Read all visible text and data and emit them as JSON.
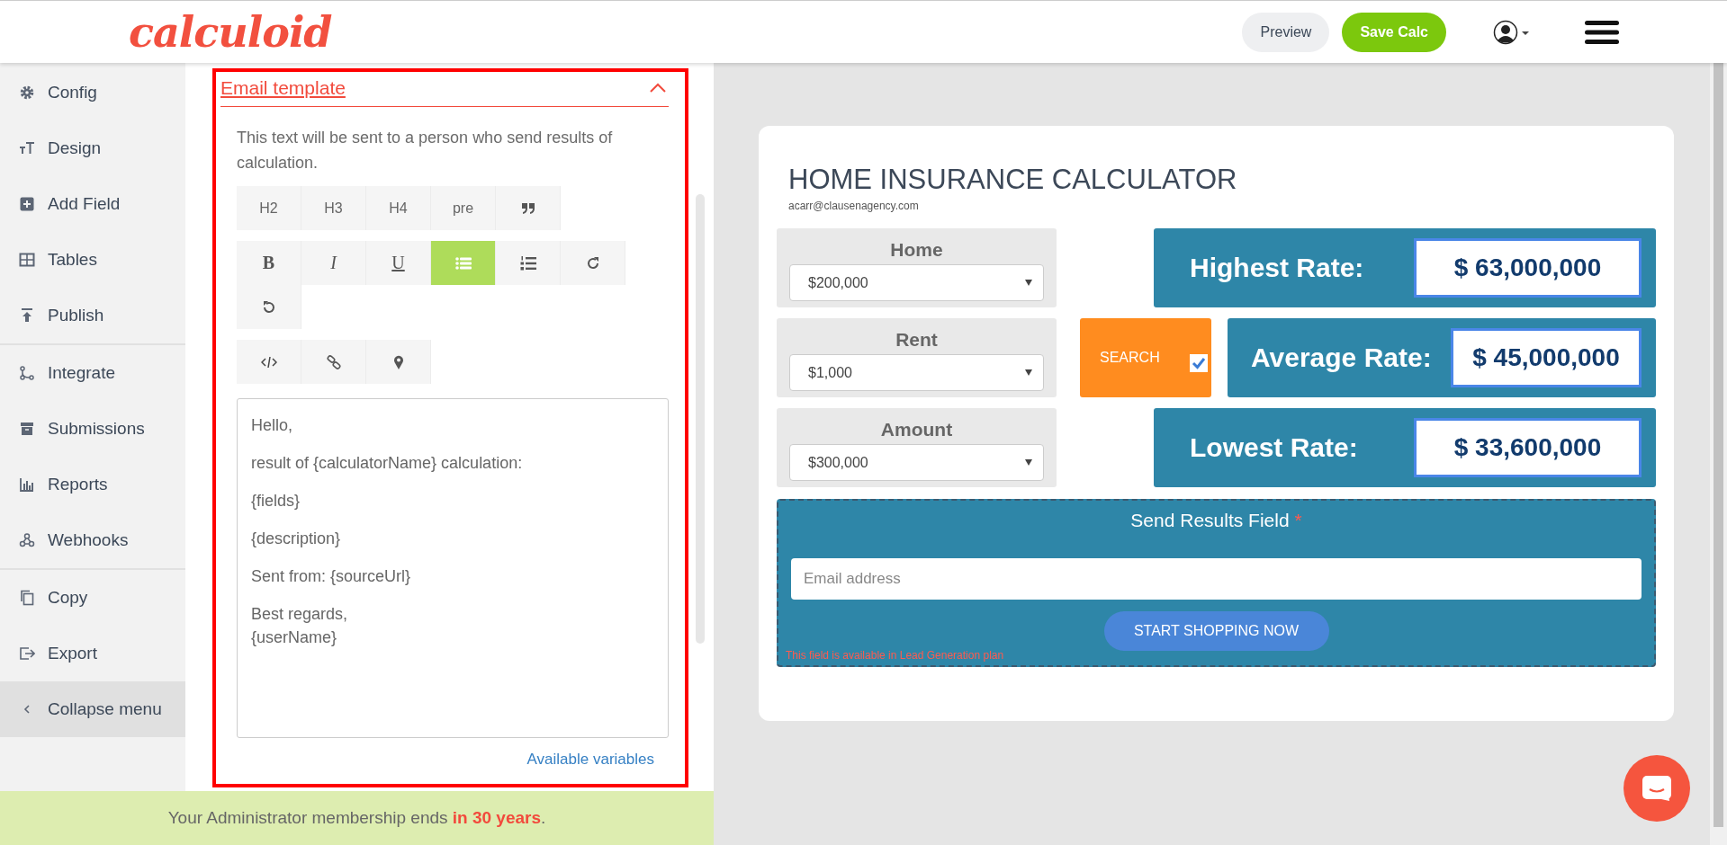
{
  "header": {
    "logo": "calculoid",
    "buttons": [
      {
        "label": "Preview",
        "kind": "secondary"
      },
      {
        "label": "Save Calc",
        "kind": "primary"
      }
    ]
  },
  "sidebar": {
    "groups": [
      [
        {
          "label": "Config",
          "kind": "gear"
        },
        {
          "label": "Design",
          "kind": "text-size"
        },
        {
          "label": "Add Field",
          "kind": "plus-square"
        },
        {
          "label": "Tables",
          "kind": "table"
        },
        {
          "label": "Publish",
          "kind": "upload"
        }
      ],
      [
        {
          "label": "Integrate",
          "kind": "branch"
        },
        {
          "label": "Submissions",
          "kind": "archive"
        },
        {
          "label": "Reports",
          "kind": "bar-chart"
        },
        {
          "label": "Webhooks",
          "kind": "webhook"
        }
      ],
      [
        {
          "label": "Copy",
          "kind": "copy"
        },
        {
          "label": "Export",
          "kind": "export"
        }
      ]
    ],
    "collapse": {
      "label": "Collapse menu",
      "selected": true
    }
  },
  "email_template": {
    "title": "Email template",
    "expanded": true,
    "description": "This text will be sent to a person who send results of calculation.",
    "toolbar": [
      [
        {
          "kind": "text",
          "label": "H2",
          "selected": false
        },
        {
          "kind": "text",
          "label": "H3",
          "selected": false
        },
        {
          "kind": "text",
          "label": "H4",
          "selected": false
        },
        {
          "kind": "text",
          "label": "pre",
          "selected": false
        },
        {
          "kind": "quote",
          "selected": false
        }
      ],
      [
        {
          "kind": "bold",
          "label": "B",
          "selected": false
        },
        {
          "kind": "italic",
          "label": "I",
          "selected": false
        },
        {
          "kind": "underline",
          "label": "U",
          "selected": false
        },
        {
          "kind": "bullet-list",
          "selected": true
        },
        {
          "kind": "numbered-list",
          "selected": false
        },
        {
          "kind": "redo",
          "selected": false
        },
        {
          "kind": "undo",
          "selected": false
        }
      ],
      [
        {
          "kind": "code",
          "selected": false
        },
        {
          "kind": "link",
          "selected": false
        },
        {
          "kind": "pin",
          "selected": false
        }
      ]
    ],
    "body": [
      [
        "Hello,"
      ],
      [
        "result of {calculatorName} calculation:"
      ],
      [
        "{fields}"
      ],
      [
        "{description}"
      ],
      [
        "Sent from: {sourceUrl}"
      ],
      [
        "Best regards,",
        "{userName}"
      ]
    ],
    "link": "Available variables"
  },
  "membership_banner": {
    "text": "Your Administrator membership ends **in 30 years**."
  },
  "calculator": {
    "title": "HOME INSURANCE CALCULATOR",
    "subtitle": "acarr@clausenagency.com",
    "fields": [
      {
        "label": "Home",
        "value": "$200,000"
      },
      {
        "label": "Rent",
        "value": "$1,000"
      },
      {
        "label": "Amount",
        "value": "$300,000"
      }
    ],
    "search": {
      "label": "SEARCH",
      "checked": true
    },
    "results": [
      {
        "label": "Highest Rate:",
        "value": "$ 63,000,000"
      },
      {
        "label": "Average Rate:",
        "value": "$ 45,000,000"
      },
      {
        "label": "Lowest Rate:",
        "value": "$ 33,600,000"
      }
    ],
    "send_results": {
      "title": "Send Results Field",
      "required_mark": "*",
      "placeholder": "Email address",
      "button": "START SHOPPING NOW",
      "note": "This field is available in Lead Generation plan"
    }
  }
}
